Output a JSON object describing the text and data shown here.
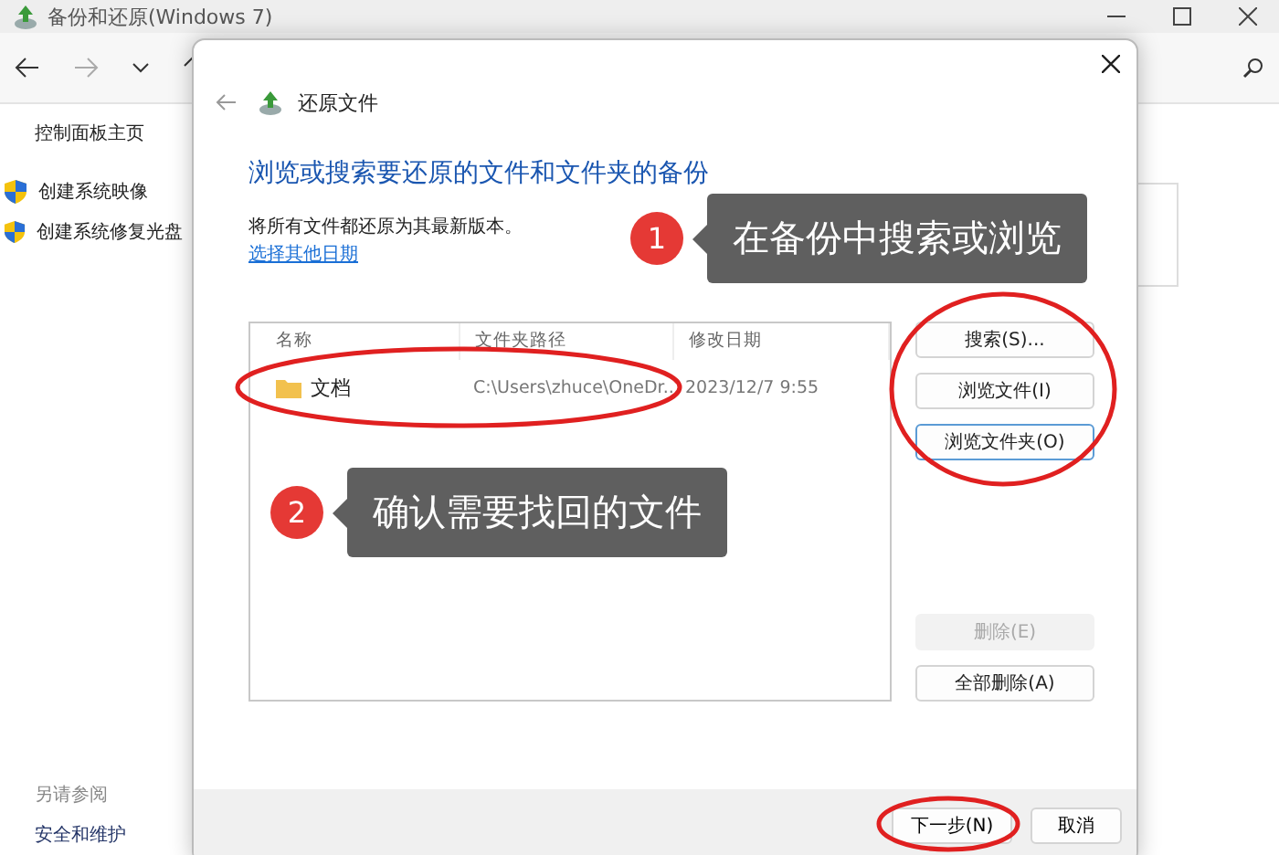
{
  "window": {
    "title": "备份和还原(Windows 7)"
  },
  "sidebar": {
    "items": [
      {
        "label": "控制面板主页",
        "kind": "link"
      },
      {
        "label": "创建系统映像",
        "kind": "shield"
      },
      {
        "label": "创建系统修复光盘",
        "kind": "shield"
      }
    ],
    "see_also": {
      "heading": "另请参阅",
      "items": [
        "安全和维护"
      ]
    }
  },
  "dialog": {
    "title": "还原文件",
    "heading": "浏览或搜索要还原的文件和文件夹的备份",
    "description": "将所有文件都还原为其最新版本。",
    "link": "选择其他日期",
    "table": {
      "columns": [
        "名称",
        "文件夹路径",
        "修改日期"
      ],
      "rows": [
        {
          "cells": [
            "文档",
            "C:\\Users\\zhuce\\OneDr...",
            "2023/12/7 9:55"
          ]
        }
      ]
    },
    "side_buttons": [
      {
        "label": "搜索(S)...",
        "disabled": false,
        "focused": false,
        "kind": "top"
      },
      {
        "label": "浏览文件(I)",
        "disabled": false,
        "focused": false,
        "kind": "top"
      },
      {
        "label": "浏览文件夹(O)",
        "disabled": false,
        "focused": true,
        "kind": "top"
      },
      {
        "label": "删除(E)",
        "disabled": true,
        "focused": false,
        "kind": "bottom"
      },
      {
        "label": "全部删除(A)",
        "disabled": false,
        "focused": false,
        "kind": "bottom"
      }
    ],
    "footer_buttons": [
      "下一步(N)",
      "取消"
    ]
  },
  "annotations": [
    {
      "number": "1",
      "text": "在备份中搜索或浏览"
    },
    {
      "number": "2",
      "text": "确认需要找回的文件"
    }
  ]
}
